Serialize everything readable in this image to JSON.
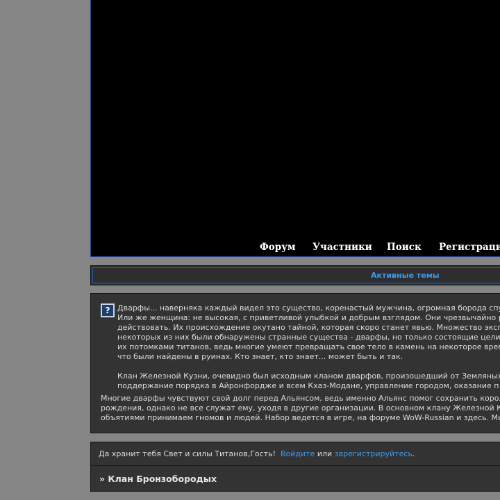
{
  "nav": {
    "items": [
      {
        "label": "Форум"
      },
      {
        "label": "Участники"
      },
      {
        "label": "Поиск"
      },
      {
        "label": "Регистрация"
      }
    ]
  },
  "active_topics": {
    "label": "Активные темы"
  },
  "announcement": {
    "para1": [
      "Дварфы... наверняка каждый видел это существо, коренастый мужчина, огромная борода спу",
      "Или же женщина: не высокая, с приветливой улыбкой и добрым взглядом. Они чрезвычайно р",
      "действовать. Их происхождение окутано тайной, которая скоро станет явью. Множество эксп",
      "некоторых из них были обнаружены странные существа - дварфы, но только состоящие цели",
      "их потомками титанов, ведь многие умеют превращать свое тело в камень на некоторое врем",
      "что были найдены в руинах. Кто знает, кто знает... может быть и так."
    ],
    "para2": [
      "Клан Железной Кузни, очевидно был исходным кланом дварфов, произошедший от Земляных",
      "поддержание порядка в Айронфордже и всем Кхаз-Модане, управление городом, оказание п"
    ],
    "para3": [
      "Многие дварфы чувствуют свой долг перед Альянсом, ведь именно Альянс помог сохранить корол",
      "рождения, однако не все служат ему, уходя в другие организации. В основном клану Железной К",
      "объятиями принимаем гномов и людей. Набор ведется в игре, на форуме WoW-Russian и здесь. Мы"
    ]
  },
  "welcome": {
    "greeting": "Да хранит тебя Свет и силы Титанов,Гость!",
    "login_link": "Войдите",
    "or": "или",
    "register_link": "зарегистрируйтесь",
    "period": "."
  },
  "section": {
    "title": "» Клан Бронзобородых"
  }
}
